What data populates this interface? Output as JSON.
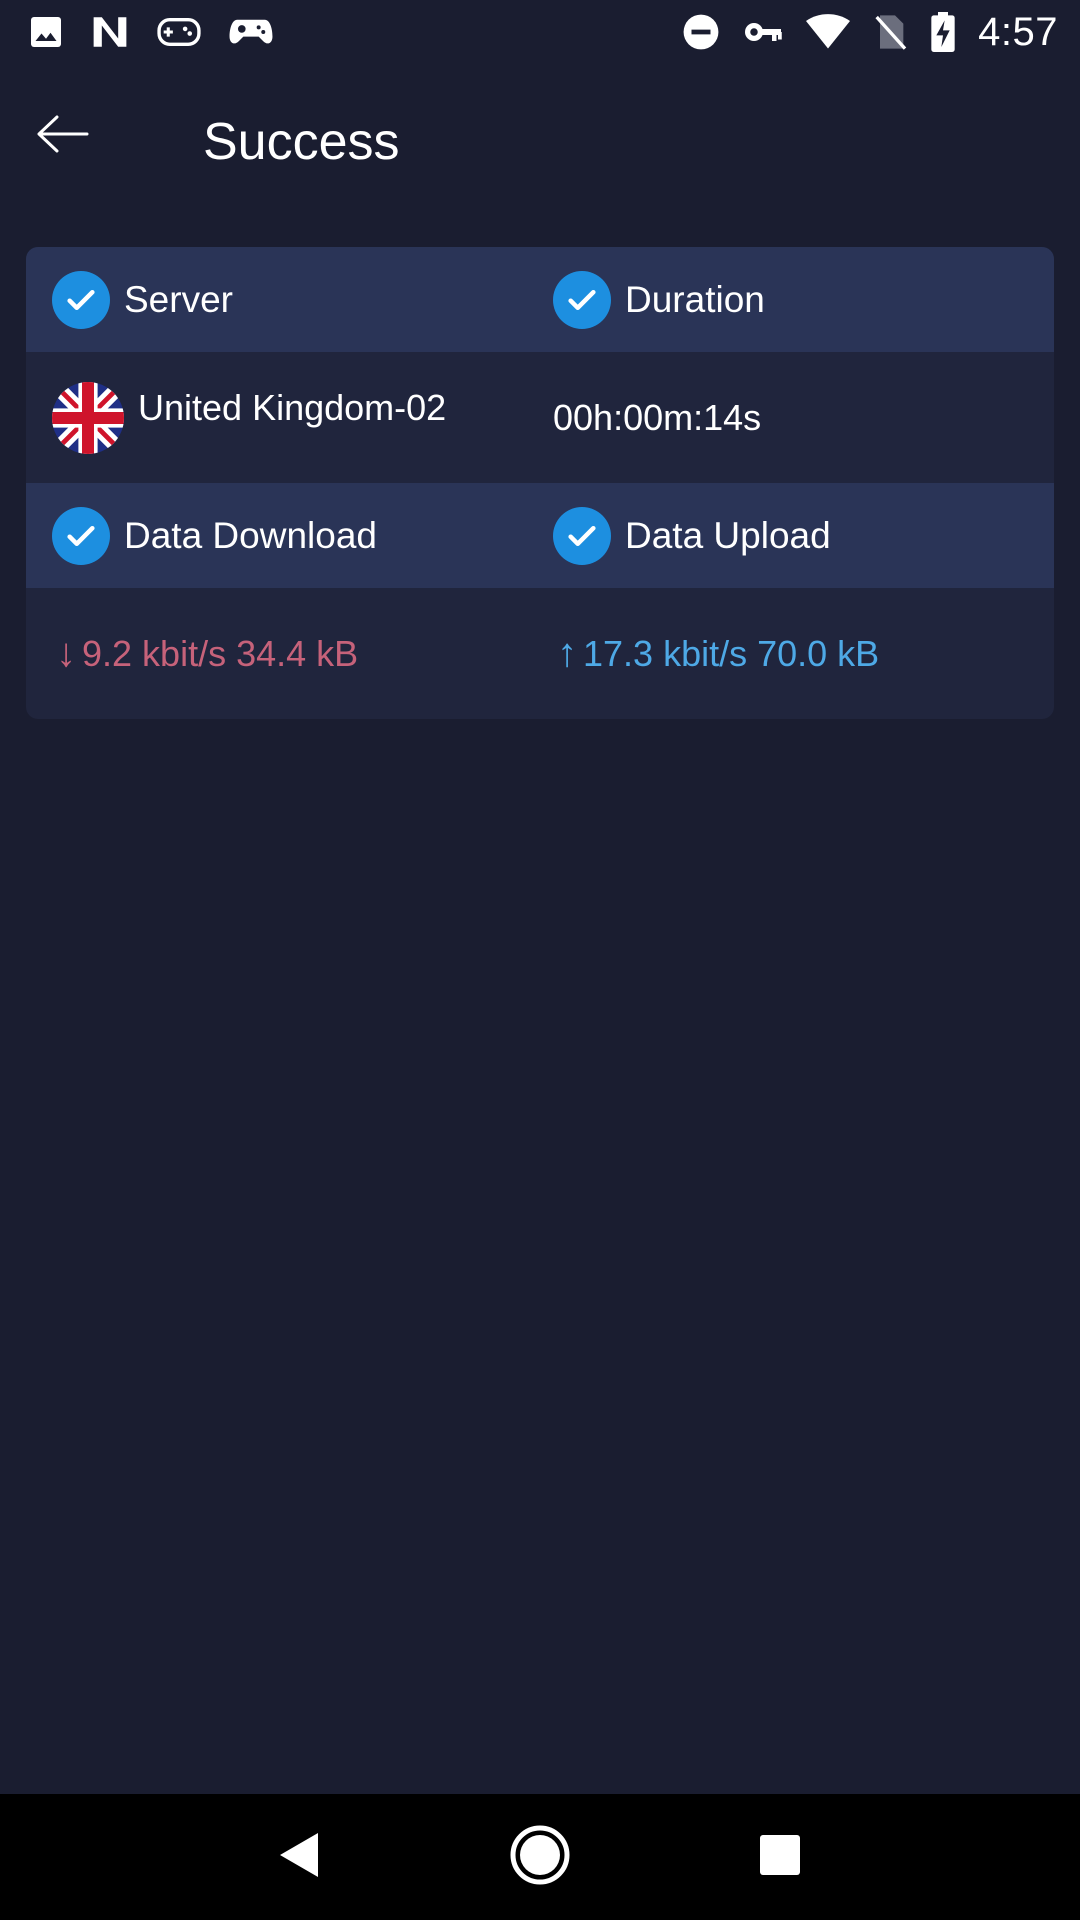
{
  "status_bar": {
    "time": "4:57",
    "left_icons": [
      "image-icon",
      "n-logo-icon",
      "gamepad-icon",
      "controller-icon"
    ],
    "right_icons": [
      "do-not-disturb-icon",
      "vpn-key-icon",
      "wifi-icon",
      "no-sim-icon",
      "battery-charging-icon"
    ]
  },
  "header": {
    "title": "Success",
    "back_icon": "arrow-back-icon"
  },
  "card": {
    "server_label": "Server",
    "duration_label": "Duration",
    "server_name": "United Kingdom-02",
    "server_flag": "uk-flag-icon",
    "duration_value": "00h:00m:14s",
    "download_label": "Data Download",
    "upload_label": "Data Upload",
    "download_arrow": "↓",
    "download_value": "9.2 kbit/s 34.4 kB",
    "upload_arrow": "↑",
    "upload_value": "17.3 kbit/s 70.0 kB"
  },
  "colors": {
    "background": "#1a1d30",
    "card": "#20253d",
    "card_header": "#2a3457",
    "check": "#1d8fe0",
    "download": "#c6627a",
    "upload": "#4ea9e6"
  },
  "nav_bar": {
    "icons": [
      "back-triangle-icon",
      "home-circle-icon",
      "recents-square-icon"
    ]
  }
}
